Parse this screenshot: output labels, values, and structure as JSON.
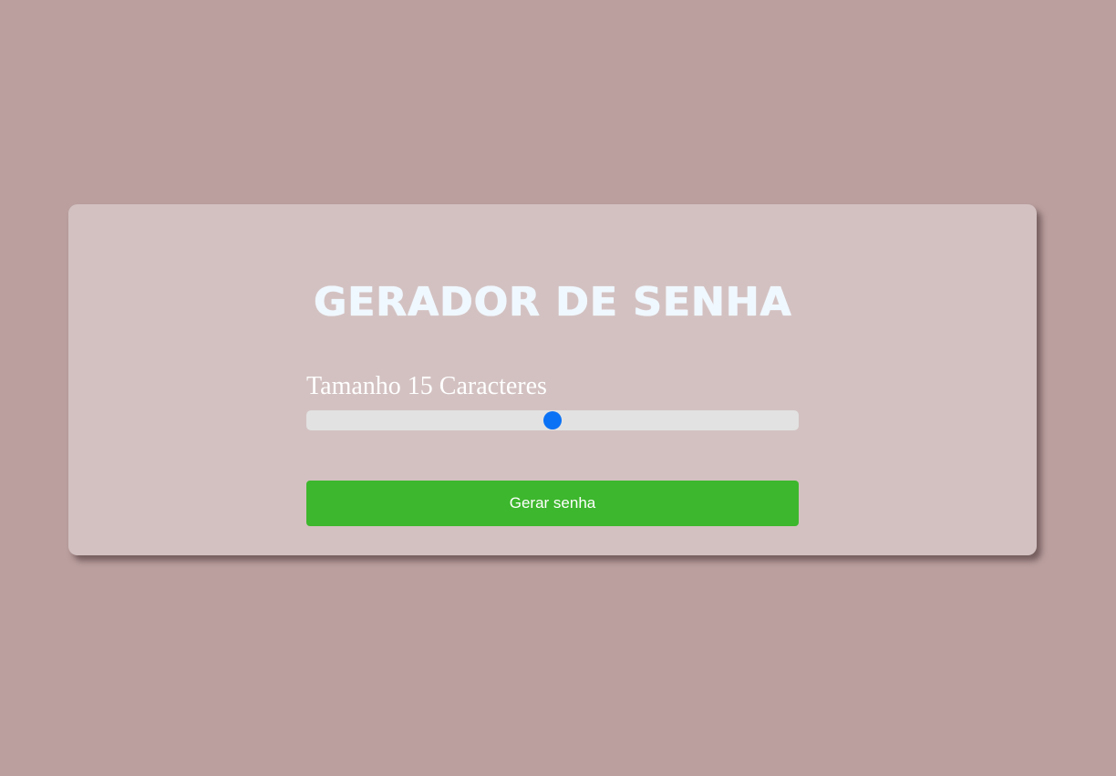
{
  "card": {
    "title": "GERADOR DE SENHA",
    "size_label": "Tamanho 15 Caracteres",
    "slider": {
      "value": 15,
      "fraction": 0.5
    },
    "generate_button_label": "Gerar senha"
  },
  "colors": {
    "background": "#bb9f9f",
    "card": "#d3c1c1",
    "button": "#3db72d",
    "slider_thumb": "#0a72f5",
    "slider_track": "#e2e2e2",
    "title": "#f0f8ff"
  }
}
